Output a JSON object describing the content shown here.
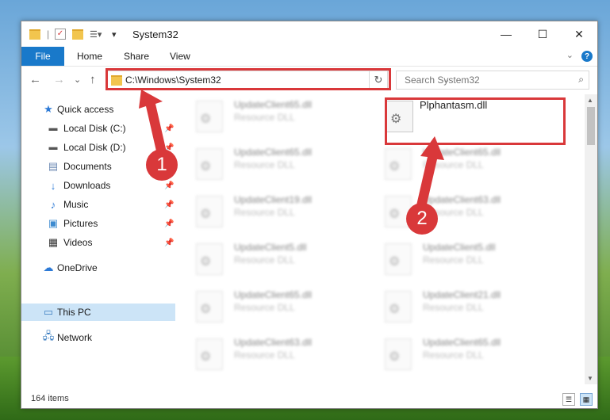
{
  "window": {
    "title": "System32",
    "controls": {
      "minimize": "—",
      "maximize": "☐",
      "close": "✕"
    }
  },
  "ribbon": {
    "file_tab": "File",
    "tabs": [
      "Home",
      "Share",
      "View"
    ],
    "help": "?"
  },
  "nav": {
    "back": "←",
    "forward": "→",
    "recent": "⌄",
    "up": "↑",
    "address": "C:\\Windows\\System32",
    "refresh": "↻",
    "search_placeholder": "Search System32"
  },
  "navpane": {
    "items": [
      {
        "label": "Quick access",
        "icon": "star-icon"
      },
      {
        "label": "Local Disk (C:)",
        "icon": "drive-icon",
        "pinned": true
      },
      {
        "label": "Local Disk (D:)",
        "icon": "drive-icon",
        "pinned": true
      },
      {
        "label": "Documents",
        "icon": "documents-icon",
        "pinned": true
      },
      {
        "label": "Downloads",
        "icon": "download-icon",
        "pinned": true
      },
      {
        "label": "Music",
        "icon": "music-icon",
        "pinned": true
      },
      {
        "label": "Pictures",
        "icon": "pictures-icon",
        "pinned": true
      },
      {
        "label": "Videos",
        "icon": "videos-icon",
        "pinned": true
      },
      {
        "label": "OneDrive",
        "icon": "cloud-icon"
      },
      {
        "label": "This PC",
        "icon": "pc-icon",
        "selected": true
      },
      {
        "label": "Network",
        "icon": "network-icon"
      }
    ]
  },
  "files": {
    "left": [
      {
        "name": "UpdateClient65.dll",
        "type": "Resource DLL"
      },
      {
        "name": "UpdateClient65.dll",
        "type": "Resource DLL"
      },
      {
        "name": "UpdateClient19.dll",
        "type": "Resource DLL"
      },
      {
        "name": "UpdateClient5.dll",
        "type": "Resource DLL"
      },
      {
        "name": "UpdateClient65.dll",
        "type": "Resource DLL"
      },
      {
        "name": "UpdateClient63.dll",
        "type": "Resource DLL"
      }
    ],
    "right": [
      {
        "name": "Plphantasm.dll",
        "type": ""
      },
      {
        "name": "UpdateClient65.dll",
        "type": "Resource DLL"
      },
      {
        "name": "UpdateClient63.dll",
        "type": "Resource DLL"
      },
      {
        "name": "UpdateClient5.dll",
        "type": "Resource DLL"
      },
      {
        "name": "UpdateClient21.dll",
        "type": "Resource DLL"
      },
      {
        "name": "UpdateClient65.dll",
        "type": "Resource DLL"
      }
    ]
  },
  "status": {
    "items_count": "164 items"
  },
  "annotations": {
    "badge1": "1",
    "badge2": "2",
    "color": "#d9383a"
  }
}
